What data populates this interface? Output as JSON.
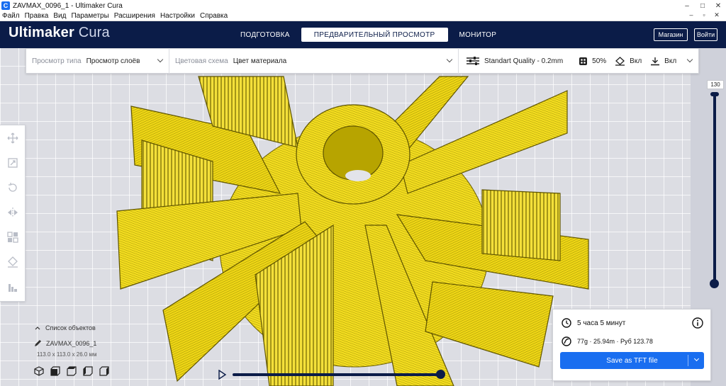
{
  "window": {
    "app_icon": "C",
    "title": "ZAVMAX_0096_1 - Ultimaker Cura",
    "controls": [
      "–",
      "□",
      "✕"
    ]
  },
  "menu": {
    "items": [
      "Файл",
      "Правка",
      "Вид",
      "Параметры",
      "Расширения",
      "Настройки",
      "Справка"
    ],
    "mdi_controls": [
      "–",
      "▫",
      "✕"
    ]
  },
  "header": {
    "brand_bold": "Ultimaker",
    "brand_light": " Cura",
    "stages": [
      "ПОДГОТОВКА",
      "ПРЕДВАРИТЕЛЬНЫЙ ПРОСМОТР",
      "МОНИТОР"
    ],
    "active_stage": 1,
    "marketplace_label": "Магазин",
    "signin_label": "Войти"
  },
  "view_settings": {
    "view_type_label": "Просмотр типа",
    "view_type_value": "Просмотр слоёв",
    "color_scheme_label": "Цветовая схема",
    "color_scheme_value": "Цвет материала"
  },
  "print_settings": {
    "profile": "Standart Quality - 0.2mm",
    "infill": "50%",
    "support": "Вкл",
    "adhesion": "Вкл"
  },
  "layer_view": {
    "current_layer": "130",
    "model_color": "#f2dc1f"
  },
  "objects": {
    "header": "Список объектов",
    "name": "ZAVMAX_0096_1",
    "dimensions": "113.0 x 113.0 x 26.0 мм"
  },
  "print_info": {
    "time": "5 часа 5 минут",
    "material": "77g · 25.94m · Руб 123.78",
    "save_label": "Save as TFT file"
  },
  "colors": {
    "header": "#0b1c48",
    "accent": "#196ef0",
    "model": "#f2dc1f"
  }
}
